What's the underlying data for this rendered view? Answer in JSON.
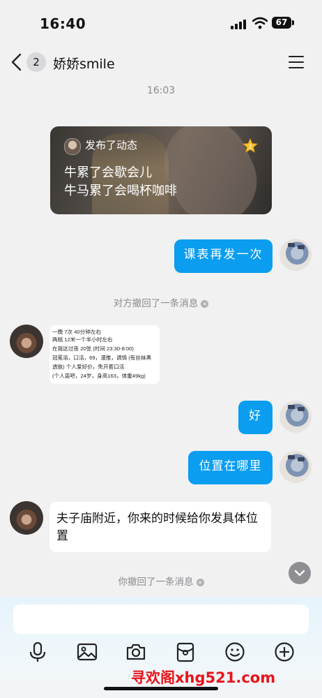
{
  "status_bar": {
    "time": "16:40",
    "battery": "67"
  },
  "header": {
    "unread_count": "2",
    "title": "娇娇smile"
  },
  "timestamp": "16:03",
  "moment_card": {
    "label": "发布了动态",
    "lines": [
      "牛累了会歇会儿",
      "牛马累了会喝杯咖啡"
    ]
  },
  "messages": {
    "sent_schedule": "课表再发一次",
    "recalled_other": "对方撤回了一条消息",
    "image_text_lines": [
      "一晚 7次 40分钟左右",
      "两桃 12米一个半小时左右",
      "在我这过夜 20张 (时间 23:30-8:00)",
      "冠冕浴，口活，69，漫推，调情 (有丝袜黑",
      "透肤) 个人爱好价，免开套口活",
      "(个人装吧，24岁，身高163，体重49kg)"
    ],
    "sent_ok": "好",
    "sent_where": "位置在哪里",
    "received_location": "夫子庙附近，你来的时候给你发具体位置",
    "recalled_self": "你撤回了一条消息"
  },
  "input": {
    "placeholder": ""
  },
  "toolbar": {
    "icons": [
      "microphone-icon",
      "image-icon",
      "camera-icon",
      "red-packet-icon",
      "emoji-icon",
      "plus-icon"
    ]
  },
  "watermark": "寻欢阁xhg521.com",
  "colors": {
    "accent_blue": "#0a9df0",
    "background": "#f1f1f2",
    "watermark_red": "#e8141b"
  }
}
